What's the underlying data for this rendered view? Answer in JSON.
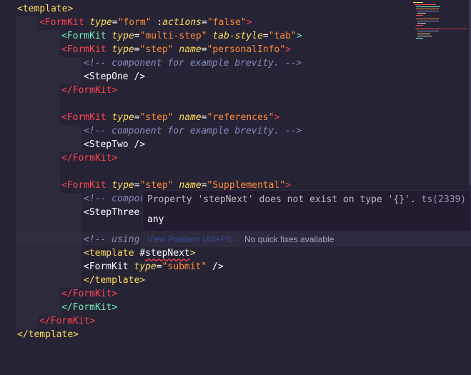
{
  "editor": {
    "lines": [
      {
        "segments": [
          {
            "t": "<template>",
            "c": "tag-o"
          }
        ]
      },
      {
        "segments": [
          {
            "t": "<FormKit",
            "c": "tag-p"
          },
          {
            "t": " ",
            "c": "pun"
          },
          {
            "t": "type",
            "c": "attr"
          },
          {
            "t": "=",
            "c": "eq"
          },
          {
            "t": "\"form\"",
            "c": "str"
          },
          {
            "t": " :",
            "c": "pun"
          },
          {
            "t": "actions",
            "c": "attr"
          },
          {
            "t": "=",
            "c": "eq"
          },
          {
            "t": "\"false\"",
            "c": "str"
          },
          {
            "t": ">",
            "c": "tag-p"
          }
        ]
      },
      {
        "segments": [
          {
            "t": "<FormKit",
            "c": "tag-g"
          },
          {
            "t": " ",
            "c": "pun"
          },
          {
            "t": "type",
            "c": "attr"
          },
          {
            "t": "=",
            "c": "eq"
          },
          {
            "t": "\"multi-step\"",
            "c": "str"
          },
          {
            "t": " ",
            "c": "pun"
          },
          {
            "t": "tab-style",
            "c": "attr"
          },
          {
            "t": "=",
            "c": "eq"
          },
          {
            "t": "\"tab\"",
            "c": "str"
          },
          {
            "t": ">",
            "c": "tag-g"
          }
        ]
      },
      {
        "segments": [
          {
            "t": "<FormKit",
            "c": "tag-p"
          },
          {
            "t": " ",
            "c": "pun"
          },
          {
            "t": "type",
            "c": "attr"
          },
          {
            "t": "=",
            "c": "eq"
          },
          {
            "t": "\"step\"",
            "c": "str"
          },
          {
            "t": " ",
            "c": "pun"
          },
          {
            "t": "name",
            "c": "attr"
          },
          {
            "t": "=",
            "c": "eq"
          },
          {
            "t": "\"personalInfo\"",
            "c": "str"
          },
          {
            "t": ">",
            "c": "tag-p"
          }
        ]
      },
      {
        "segments": [
          {
            "t": "<!-- component for example brevity. -->",
            "c": "cmt"
          }
        ]
      },
      {
        "segments": [
          {
            "t": "<StepOne />",
            "c": "tag-w"
          }
        ]
      },
      {
        "segments": [
          {
            "t": "</FormKit>",
            "c": "tag-p"
          }
        ]
      },
      {
        "segments": []
      },
      {
        "segments": [
          {
            "t": "<FormKit",
            "c": "tag-p"
          },
          {
            "t": " ",
            "c": "pun"
          },
          {
            "t": "type",
            "c": "attr"
          },
          {
            "t": "=",
            "c": "eq"
          },
          {
            "t": "\"step\"",
            "c": "str"
          },
          {
            "t": " ",
            "c": "pun"
          },
          {
            "t": "name",
            "c": "attr"
          },
          {
            "t": "=",
            "c": "eq"
          },
          {
            "t": "\"references\"",
            "c": "str"
          },
          {
            "t": ">",
            "c": "tag-p"
          }
        ]
      },
      {
        "segments": [
          {
            "t": "<!-- component for example brevity. -->",
            "c": "cmt"
          }
        ]
      },
      {
        "segments": [
          {
            "t": "<StepTwo />",
            "c": "tag-w"
          }
        ]
      },
      {
        "segments": [
          {
            "t": "</FormKit>",
            "c": "tag-p"
          }
        ]
      },
      {
        "segments": []
      },
      {
        "segments": [
          {
            "t": "<FormKit",
            "c": "tag-p"
          },
          {
            "t": " ",
            "c": "pun"
          },
          {
            "t": "type",
            "c": "attr"
          },
          {
            "t": "=",
            "c": "eq"
          },
          {
            "t": "\"step\"",
            "c": "str"
          },
          {
            "t": " ",
            "c": "pun"
          },
          {
            "t": "name",
            "c": "attr"
          },
          {
            "t": "=",
            "c": "eq"
          },
          {
            "t": "\"Supplemental\"",
            "c": "str"
          },
          {
            "t": ">",
            "c": "tag-p"
          }
        ]
      },
      {
        "segments": [
          {
            "t": "<!-- compor",
            "c": "cmt"
          }
        ]
      },
      {
        "segments": [
          {
            "t": "<StepThree",
            "c": "tag-w"
          }
        ]
      },
      {
        "segments": []
      },
      {
        "segments": [
          {
            "t": "<!-- using",
            "c": "cmt"
          }
        ]
      },
      {
        "segments": [
          {
            "t": "<template",
            "c": "tag-o"
          },
          {
            "t": " #",
            "c": "pun"
          },
          {
            "t": "stepNext",
            "c": "squig"
          },
          {
            "t": ">",
            "c": "tag-o"
          }
        ]
      },
      {
        "segments": [
          {
            "t": "<FormKit",
            "c": "tag-w"
          },
          {
            "t": " ",
            "c": "pun"
          },
          {
            "t": "type",
            "c": "attr"
          },
          {
            "t": "=",
            "c": "eq"
          },
          {
            "t": "\"submit\"",
            "c": "str"
          },
          {
            "t": " />",
            "c": "tag-w"
          }
        ]
      },
      {
        "segments": [
          {
            "t": "</template>",
            "c": "tag-o"
          }
        ]
      },
      {
        "segments": [
          {
            "t": "</FormKit>",
            "c": "tag-p"
          }
        ]
      },
      {
        "segments": [
          {
            "t": "</FormKit>",
            "c": "tag-g"
          }
        ]
      },
      {
        "segments": [
          {
            "t": "</FormKit>",
            "c": "tag-p"
          }
        ]
      },
      {
        "segments": [
          {
            "t": "</template>",
            "c": "tag-o"
          }
        ]
      }
    ]
  },
  "hover": {
    "message": "Property 'stepNext' does not exist on type '{}'.",
    "code": " ts(2339)",
    "type_text": "any",
    "view_problem": "View Problem (Alt+F8)",
    "no_fixes": "No quick fixes available"
  }
}
